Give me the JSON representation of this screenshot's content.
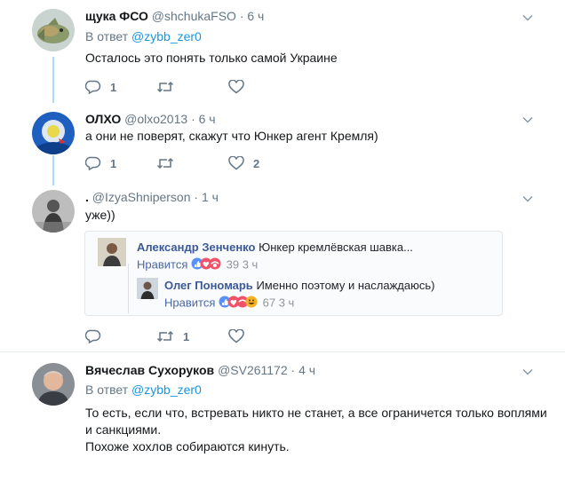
{
  "tweets": [
    {
      "name": "щука ФСО",
      "handle": "@shchukaFSO",
      "dot": "·",
      "time": "6 ч",
      "reply_prefix": "В ответ",
      "reply_to": "@zybb_zer0",
      "text": "Осталось это понять только самой Украине",
      "replies": "1",
      "retweets": "",
      "likes": ""
    },
    {
      "name": "ОЛХО",
      "handle": "@olxo2013",
      "dot": "·",
      "time": "6 ч",
      "text": "а они не поверят, скажут что Юнкер агент Кремля)",
      "replies": "1",
      "retweets": "",
      "likes": "2"
    },
    {
      "name": ".",
      "handle": "@IzyaShniperson",
      "dot": "·",
      "time": "1 ч",
      "text": "уже))",
      "replies": "",
      "retweets": "1",
      "likes": ""
    },
    {
      "name": "Вячеслав Сухоруков",
      "handle": "@SV261172",
      "dot": "·",
      "time": "4 ч",
      "reply_prefix": "В ответ",
      "reply_to": "@zybb_zer0",
      "text_line1": "То есть, если что, встревать никто не станет, а все ограничется только воплями",
      "text_line2": "и санкциями.",
      "text_line3": "Похоже хохлов собираются кинуть."
    }
  ],
  "quote": {
    "comment1": {
      "name": "Александр Зенченко",
      "text": "Юнкер кремлёвская шавка...",
      "like_label": "Нравится",
      "count": "39",
      "time": "3 ч"
    },
    "comment2": {
      "name": "Олег Пономарь",
      "text": "Именно поэтому и наслаждаюсь)",
      "like_label": "Нравится",
      "count": "67",
      "time": "3 ч"
    }
  },
  "colors": {
    "link": "#1b95e0",
    "muted": "#657786",
    "thread_line": "#aadcf5",
    "fb_name": "#3b5998"
  }
}
